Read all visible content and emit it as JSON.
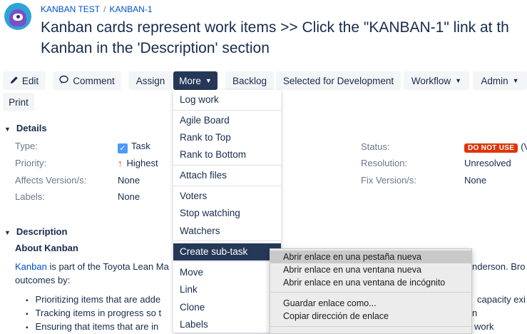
{
  "header": {
    "breadcrumb": [
      "KANBAN TEST",
      "KANBAN-1"
    ],
    "breadcrumb_sep": "/",
    "title_line1": "Kanban cards represent work items >> Click the \"KANBAN-1\" link at th",
    "title_line2": "Kanban in the 'Description' section"
  },
  "toolbar": {
    "edit": "Edit",
    "comment": "Comment",
    "assign": "Assign",
    "more": "More",
    "backlog": "Backlog",
    "selected_for_dev": "Selected for Development",
    "workflow": "Workflow",
    "admin": "Admin",
    "print": "Print"
  },
  "details": {
    "heading": "Details",
    "type_label": "Type:",
    "type_value": "Task",
    "priority_label": "Priority:",
    "priority_value": "Highest",
    "affects_label": "Affects Version/s:",
    "affects_value": "None",
    "labels_label": "Labels:",
    "labels_value": "None",
    "status_label": "Status:",
    "status_value": "DO NOT USE",
    "status_suffix": "(V",
    "resolution_label": "Resolution:",
    "resolution_value": "Unresolved",
    "fix_label": "Fix Version/s:",
    "fix_value": "None",
    "status_color": "#de350b"
  },
  "description": {
    "heading": "Description",
    "subheading": "About Kanban",
    "para_link": "Kanban",
    "para_text": " is part of the Toyota Lean Ma",
    "para_right": "nderson. Bro",
    "para_line2": "outcomes by:",
    "bullets": [
      "Prioritizing items that are adde",
      "Tracking items in progress so t",
      "Ensuring that items that are in"
    ],
    "bullets_right": [
      "capacity exi",
      "n",
      "work"
    ]
  },
  "more_menu": {
    "items": [
      "Log work",
      "Agile Board",
      "Rank to Top",
      "Rank to Bottom",
      "Attach files",
      "Voters",
      "Stop watching",
      "Watchers",
      "Create sub-task",
      "Move",
      "Link",
      "Clone",
      "Labels"
    ]
  },
  "context_menu": {
    "items": [
      "Abrir enlace en una pestaña nueva",
      "Abrir enlace en una ventana nueva",
      "Abrir enlace en una ventana de incógnito",
      "Guardar enlace como...",
      "Copiar dirección de enlace"
    ]
  },
  "icons": {
    "edit": "pencil-icon",
    "comment": "comment-icon",
    "chevron": "chevron-down-icon",
    "task": "checkbox-icon",
    "priority": "arrow-up-icon"
  }
}
